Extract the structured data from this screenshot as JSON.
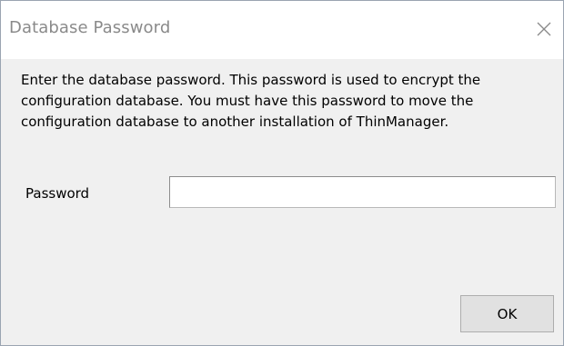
{
  "window": {
    "title": "Database Password",
    "close_icon": "close-icon"
  },
  "message": {
    "line1": "Enter the database password. This password is used to encrypt the",
    "line2": "configuration database. You must have this password to move the",
    "line3": "configuration database to another installation of ThinManager."
  },
  "password": {
    "label": "Password",
    "value": ""
  },
  "buttons": {
    "ok_label": "OK"
  }
}
